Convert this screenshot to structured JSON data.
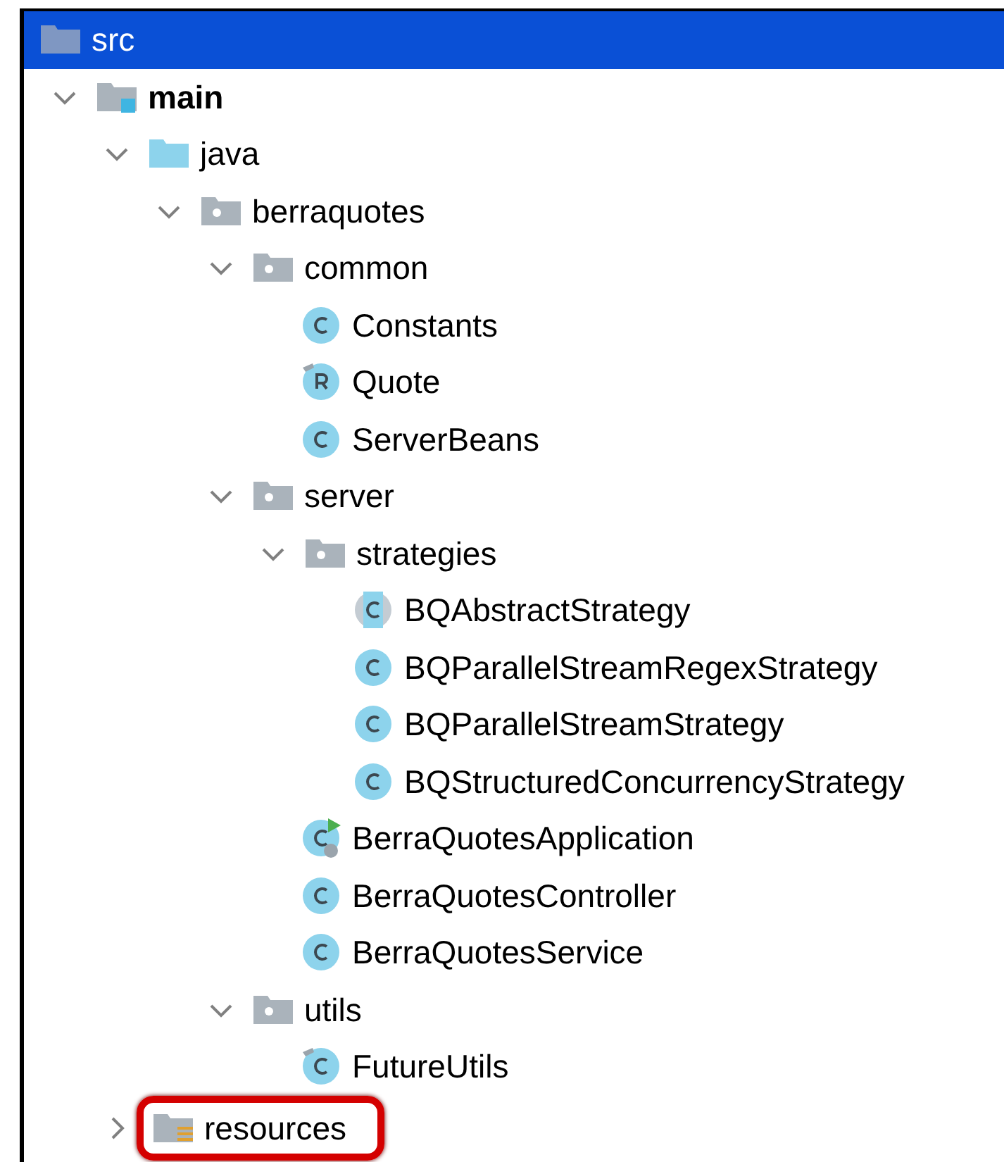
{
  "tree": [
    {
      "name": "src",
      "kind": "folder",
      "selected": true,
      "highlighted": false,
      "children": [
        {
          "name": "main",
          "kind": "module",
          "expanded": true,
          "selected": false,
          "highlighted": false,
          "children": [
            {
              "name": "java",
              "kind": "source-root",
              "expanded": true,
              "selected": false,
              "highlighted": false,
              "children": [
                {
                  "name": "berraquotes",
                  "kind": "package",
                  "expanded": true,
                  "selected": false,
                  "highlighted": false,
                  "children": [
                    {
                      "name": "common",
                      "kind": "package",
                      "expanded": true,
                      "selected": false,
                      "highlighted": false,
                      "children": [
                        {
                          "name": "Constants",
                          "kind": "class",
                          "selected": false,
                          "highlighted": false
                        },
                        {
                          "name": "Quote",
                          "kind": "record",
                          "selected": false,
                          "highlighted": false
                        },
                        {
                          "name": "ServerBeans",
                          "kind": "class",
                          "selected": false,
                          "highlighted": false
                        }
                      ]
                    },
                    {
                      "name": "server",
                      "kind": "package",
                      "expanded": true,
                      "selected": false,
                      "highlighted": false,
                      "children": [
                        {
                          "name": "strategies",
                          "kind": "package",
                          "expanded": true,
                          "selected": false,
                          "highlighted": false,
                          "children": [
                            {
                              "name": "BQAbstractStrategy",
                              "kind": "abstract",
                              "selected": false,
                              "highlighted": false
                            },
                            {
                              "name": "BQParallelStreamRegexStrategy",
                              "kind": "class",
                              "selected": false,
                              "highlighted": false
                            },
                            {
                              "name": "BQParallelStreamStrategy",
                              "kind": "class",
                              "selected": false,
                              "highlighted": false
                            },
                            {
                              "name": "BQStructuredConcurrencyStrategy",
                              "kind": "class",
                              "selected": false,
                              "highlighted": false
                            }
                          ]
                        },
                        {
                          "name": "BerraQuotesApplication",
                          "kind": "application",
                          "selected": false,
                          "highlighted": false
                        },
                        {
                          "name": "BerraQuotesController",
                          "kind": "class",
                          "selected": false,
                          "highlighted": false
                        },
                        {
                          "name": "BerraQuotesService",
                          "kind": "class",
                          "selected": false,
                          "highlighted": false
                        }
                      ]
                    },
                    {
                      "name": "utils",
                      "kind": "package",
                      "expanded": true,
                      "selected": false,
                      "highlighted": false,
                      "children": [
                        {
                          "name": "FutureUtils",
                          "kind": "final-class",
                          "selected": false,
                          "highlighted": false
                        }
                      ]
                    }
                  ]
                }
              ]
            },
            {
              "name": "resources",
              "kind": "resources",
              "expanded": false,
              "selected": false,
              "highlighted": true
            }
          ]
        }
      ]
    }
  ]
}
